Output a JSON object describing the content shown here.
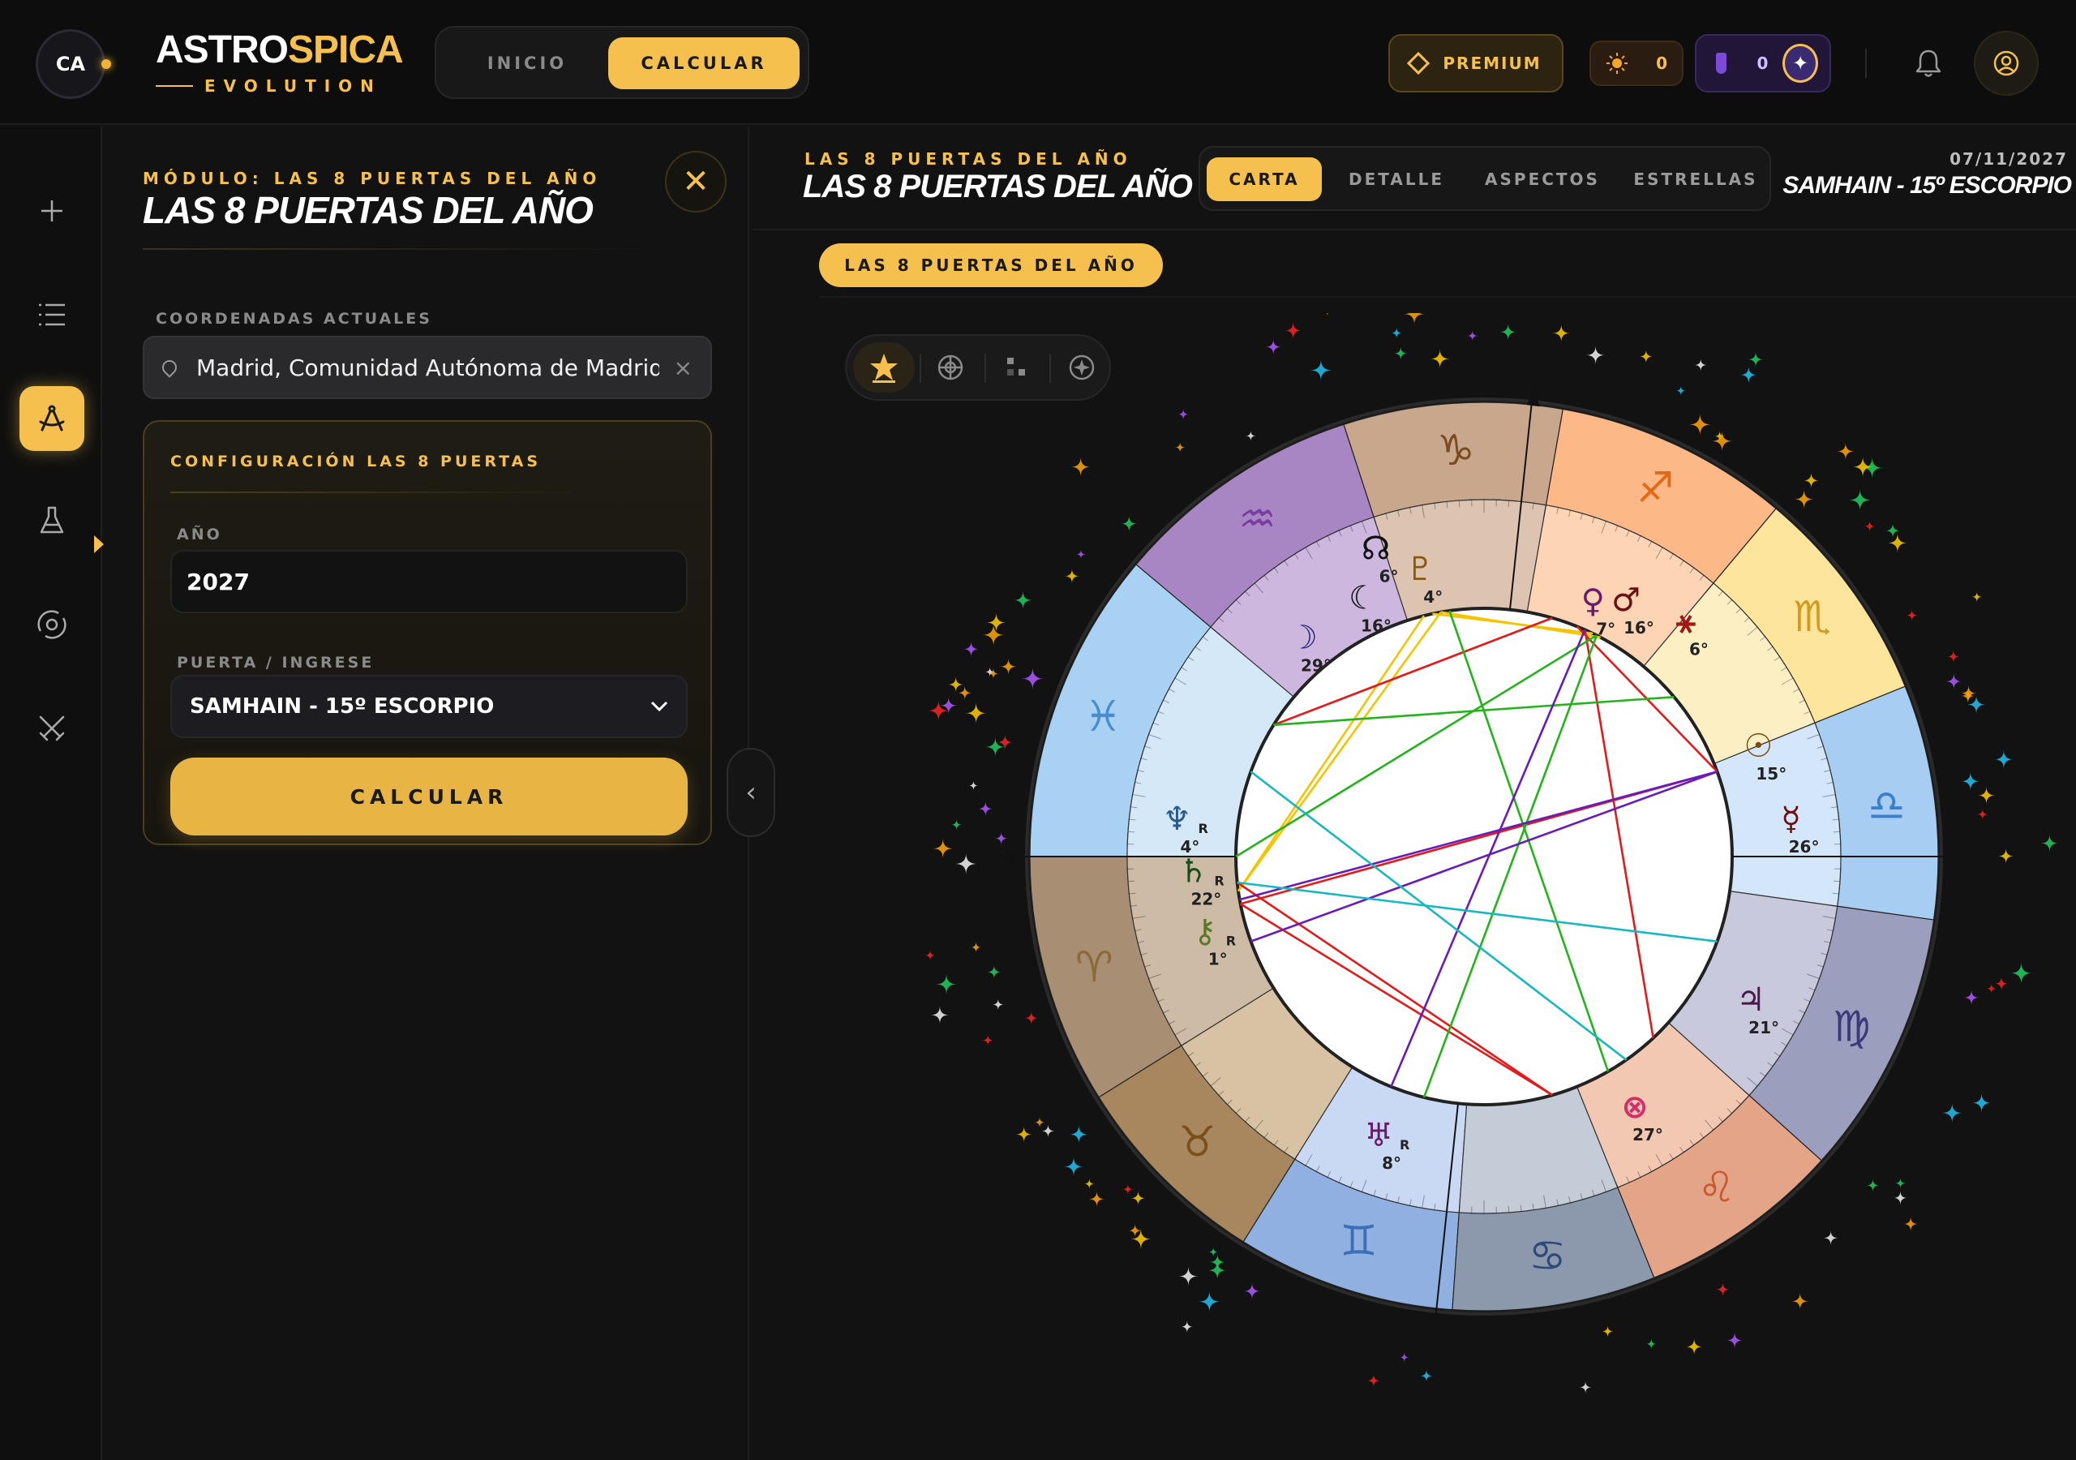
{
  "header": {
    "avatar_initials": "CA",
    "brand_part1": "ASTRO",
    "brand_part2": "SPICA",
    "brand_sub": "EVOLUTION",
    "nav": {
      "inicio": "INICIO",
      "calcular": "CALCULAR"
    },
    "premium_label": "PREMIUM",
    "sun_count": "0",
    "vial_count": "0"
  },
  "rail": {
    "icons": [
      "plus-icon",
      "list-icon",
      "compass-icon",
      "flask-icon",
      "orbit-icon",
      "swords-icon"
    ],
    "active": "compass-icon"
  },
  "panel": {
    "kicker": "MÓDULO: LAS 8 PUERTAS DEL AÑO",
    "title": "LAS 8 PUERTAS DEL AÑO",
    "coords_label": "COORDENADAS ACTUALES",
    "location_value": "Madrid, Comunidad Autónoma de Madrid,",
    "config_title": "CONFIGURACIÓN LAS 8 PUERTAS",
    "year_label": "AÑO",
    "year_value": "2027",
    "gate_label": "PUERTA / INGRESE",
    "gate_value": "SAMHAIN - 15º ESCORPIO",
    "calc_button": "CALCULAR"
  },
  "main": {
    "kicker": "LAS 8 PUERTAS DEL AÑO",
    "title": "LAS 8 PUERTAS DEL AÑO",
    "tabs": [
      "CARTA",
      "DETALLE",
      "ASPECTOS",
      "ESTRELLAS"
    ],
    "active_tab": "CARTA",
    "date": "07/11/2027",
    "gate_title": "SAMHAIN - 15º ESCORPIO",
    "chip": "LAS 8 PUERTAS DEL AÑO",
    "chart_tools": [
      "star-icon",
      "target-icon",
      "aspects-grid-icon",
      "compass-star-icon"
    ]
  },
  "wheel": {
    "signs": [
      {
        "name": "aries",
        "glyph": "♈",
        "color": "#8b6a3a"
      },
      {
        "name": "taurus",
        "glyph": "♉",
        "color": "#7a4f1e"
      },
      {
        "name": "gemini",
        "glyph": "♊",
        "color": "#3b6fb6"
      },
      {
        "name": "cancer",
        "glyph": "♋",
        "color": "#2f4a78"
      },
      {
        "name": "leo",
        "glyph": "♌",
        "color": "#c9582a"
      },
      {
        "name": "virgo",
        "glyph": "♍",
        "color": "#3b3a7a"
      },
      {
        "name": "libra",
        "glyph": "♎",
        "color": "#3d7fcf"
      },
      {
        "name": "scorpio",
        "glyph": "♏",
        "color": "#d49a1e"
      },
      {
        "name": "sagittarius",
        "glyph": "♐",
        "color": "#e06a17"
      },
      {
        "name": "capricorn",
        "glyph": "♑",
        "color": "#7a4a20"
      },
      {
        "name": "aquarius",
        "glyph": "♒",
        "color": "#7a3ca0"
      },
      {
        "name": "pisces",
        "glyph": "♓",
        "color": "#4a8cd0"
      }
    ],
    "planets": [
      {
        "name": "node",
        "glyph": "☊",
        "degree": "6°",
        "color": "#111"
      },
      {
        "name": "pluto",
        "glyph": "♇",
        "degree": "4°",
        "color": "#8a5a10"
      },
      {
        "name": "moon-black",
        "glyph": "☾",
        "degree": "16°",
        "color": "#111"
      },
      {
        "name": "moon",
        "glyph": "☽",
        "degree": "29°",
        "color": "#2a2a7a"
      },
      {
        "name": "mars",
        "glyph": "♂",
        "degree": "16°",
        "color": "#6a1010"
      },
      {
        "name": "part",
        "glyph": "⚹",
        "degree": "6°",
        "color": "#a01818"
      },
      {
        "name": "venus",
        "glyph": "♀",
        "degree": "7°",
        "color": "#6a1a6a"
      },
      {
        "name": "sun",
        "glyph": "☉",
        "degree": "15°",
        "color": "#7a4a10"
      },
      {
        "name": "mercury",
        "glyph": "☿",
        "degree": "26°",
        "color": "#6a1010"
      },
      {
        "name": "jupiter",
        "glyph": "♃",
        "degree": "21°",
        "color": "#4a1a4a"
      },
      {
        "name": "neptune",
        "glyph": "♆",
        "degree": "4°",
        "color": "#2a5a8a",
        "retro": "R"
      },
      {
        "name": "saturn",
        "glyph": "♄",
        "degree": "22°",
        "color": "#1a4a1a",
        "retro": "R"
      },
      {
        "name": "chiron",
        "glyph": "⚷",
        "degree": "1°",
        "color": "#5a7a2a",
        "retro": "R"
      },
      {
        "name": "uranus",
        "glyph": "♅",
        "degree": "8°",
        "color": "#6a1a6a",
        "retro": "R"
      },
      {
        "name": "fortune",
        "glyph": "⊗",
        "degree": "27°",
        "color": "#d0306a"
      }
    ]
  }
}
